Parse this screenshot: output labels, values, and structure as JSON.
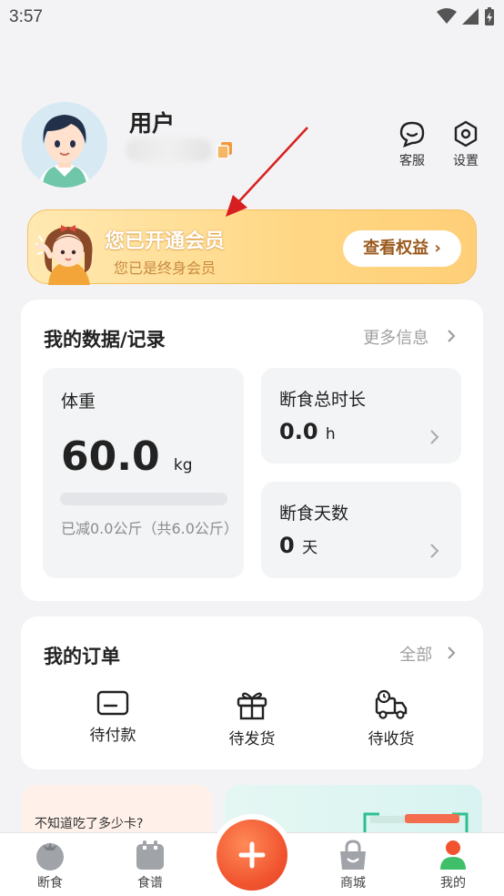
{
  "status_bar": {
    "time": "3:57"
  },
  "profile": {
    "username": "用户"
  },
  "top_actions": [
    {
      "label": "客服",
      "icon": "chat-bubble-icon"
    },
    {
      "label": "设置",
      "icon": "hexagon-gear-icon"
    }
  ],
  "vip_banner": {
    "title": "您已开通会员",
    "subtitle": "您已是终身会员",
    "button_label": "查看权益 ›"
  },
  "data_card": {
    "title": "我的数据/记录",
    "more_label": "更多信息",
    "weight": {
      "label": "体重",
      "value": "60.0",
      "unit": "kg",
      "progress": 0,
      "note": "已减0.0公斤（共6.0公斤）"
    },
    "fasting_total": {
      "label": "断食总时长",
      "value": "0.0",
      "unit": "h"
    },
    "fasting_days": {
      "label": "断食天数",
      "value": "0",
      "unit": "天"
    }
  },
  "orders_card": {
    "title": "我的订单",
    "more_label": "全部",
    "items": [
      {
        "label": "待付款",
        "icon": "card-icon"
      },
      {
        "label": "待发货",
        "icon": "gift-icon"
      },
      {
        "label": "待收货",
        "icon": "delivery-truck-icon"
      }
    ]
  },
  "promo": {
    "left_text": "不知道吃了多少卡?"
  },
  "tab_bar": [
    {
      "label": "断食",
      "icon": "tomato-icon"
    },
    {
      "label": "食谱",
      "icon": "recipe-book-icon"
    },
    {
      "label": "商城",
      "icon": "shopping-bag-icon"
    },
    {
      "label": "我的",
      "icon": "person-icon"
    }
  ],
  "colors": {
    "accent": "#f0532e",
    "vip_gold": "#ffd784",
    "active_tab": "#f0532e"
  }
}
